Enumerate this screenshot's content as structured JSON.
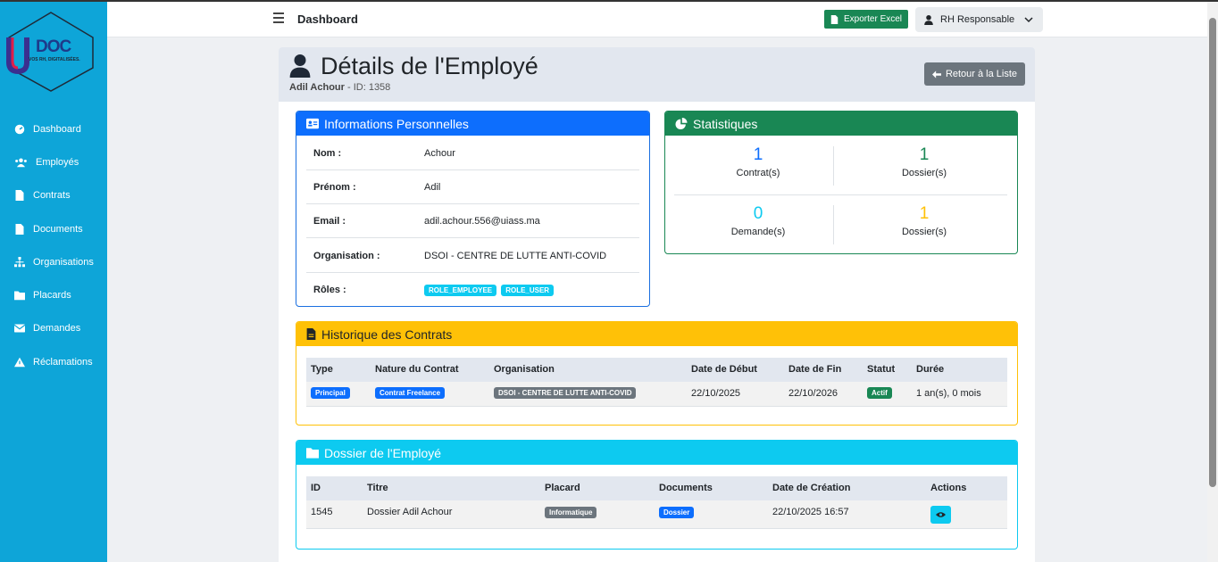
{
  "app": {
    "logo_text": "DOC",
    "logo_tagline": "VOS RH, DIGITALISÉES."
  },
  "sidebar": {
    "items": [
      {
        "label": "Dashboard",
        "icon": "dashboard-icon"
      },
      {
        "label": "Employés",
        "icon": "users-icon"
      },
      {
        "label": "Contrats",
        "icon": "file-icon"
      },
      {
        "label": "Documents",
        "icon": "file-icon"
      },
      {
        "label": "Organisations",
        "icon": "sitemap-icon"
      },
      {
        "label": "Placards",
        "icon": "folder-icon"
      },
      {
        "label": "Demandes",
        "icon": "envelope-icon"
      },
      {
        "label": "Réclamations",
        "icon": "warning-icon"
      }
    ]
  },
  "topbar": {
    "title": "Dashboard",
    "export_label": "Exporter Excel",
    "user_label": "RH Responsable"
  },
  "page": {
    "title": "Détails de l'Employé",
    "subtitle_name": "Adil Achour",
    "subtitle_id": " - ID: 1358",
    "back_label": "Retour à la Liste"
  },
  "info": {
    "title": "Informations Personnelles",
    "rows": [
      {
        "label": "Nom :",
        "value": "Achour"
      },
      {
        "label": "Prénom :",
        "value": "Adil"
      },
      {
        "label": "Email :",
        "value": "adil.achour.556@uiass.ma"
      },
      {
        "label": "Organisation :",
        "value": "DSOI - CENTRE DE LUTTE ANTI-COVID"
      }
    ],
    "roles_label": "Rôles :",
    "roles": [
      "ROLE_EMPLOYEE",
      "ROLE_USER"
    ]
  },
  "stats": {
    "title": "Statistiques",
    "items": [
      {
        "value": "1",
        "label": "Contrat(s)",
        "color": "#0d6efd"
      },
      {
        "value": "1",
        "label": "Dossier(s)",
        "color": "#198754"
      },
      {
        "value": "0",
        "label": "Demande(s)",
        "color": "#0dcaf0"
      },
      {
        "value": "1",
        "label": "Dossier(s)",
        "color": "#ffc107"
      }
    ]
  },
  "contracts": {
    "title": "Historique des Contrats",
    "headers": [
      "Type",
      "Nature du Contrat",
      "Organisation",
      "Date de Début",
      "Date de Fin",
      "Statut",
      "Durée"
    ],
    "row": {
      "type": "Principal",
      "nature": "Contrat Freelance",
      "organisation": "DSOI - CENTRE DE LUTTE ANTI-COVID",
      "start": "22/10/2025",
      "end": "22/10/2026",
      "status": "Actif",
      "duration": "1 an(s), 0 mois"
    }
  },
  "dossier": {
    "title": "Dossier de l'Employé",
    "headers": [
      "ID",
      "Titre",
      "Placard",
      "Documents",
      "Date de Création",
      "Actions"
    ],
    "row": {
      "id": "1545",
      "titre": "Dossier Adil Achour",
      "placard": "Informatique",
      "documents": "Dossier",
      "created": "22/10/2025 16:57"
    }
  }
}
